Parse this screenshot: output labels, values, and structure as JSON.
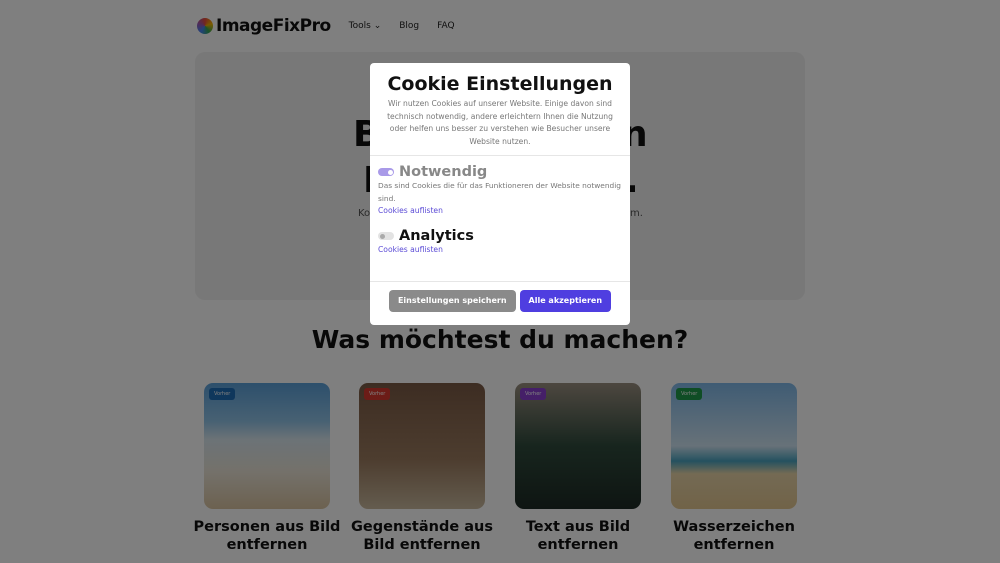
{
  "nav": {
    "logo": "ImageFixPro",
    "tools": "Tools",
    "tools_caret": "⌄",
    "blog": "Blog",
    "faq": "FAQ"
  },
  "hero": {
    "frag1_left": "B",
    "frag1_right": "n",
    "frag2_left": "I",
    "frag2_right": ".",
    "sub_left": "Ko",
    "sub_right": "m."
  },
  "section_title": "Was möchtest du machen?",
  "cards": [
    {
      "badge": "Vorher",
      "title": "Personen aus Bild entfernen",
      "badge_color": "#1f6fb8"
    },
    {
      "badge": "Vorher",
      "title": "Gegenstände aus Bild entfernen",
      "badge_color": "#d9392f"
    },
    {
      "badge": "Vorher",
      "title": "Text aus Bild entfernen",
      "badge_color": "#8a3fd1"
    },
    {
      "badge": "Vorher",
      "title": "Wasserzeichen entfernen",
      "badge_color": "#1e9a4a"
    }
  ],
  "modal": {
    "title": "Cookie Einstellungen",
    "description": "Wir nutzen Cookies auf unserer Website. Einige davon sind technisch notwendig, andere erleichtern Ihnen die Nutzung oder helfen uns besser zu verstehen wie Besucher unsere Website nutzen.",
    "sections": [
      {
        "title": "Notwendig",
        "enabled": true,
        "disabled_toggle": true,
        "description": "Das sind Cookies die für das Funktioneren der Website notwendig sind.",
        "link": "Cookies auflisten"
      },
      {
        "title": "Analytics",
        "enabled": false,
        "description": "",
        "link": "Cookies auflisten"
      }
    ],
    "save_label": "Einstellungen speichern",
    "accept_label": "Alle akzeptieren",
    "accent": "#4f3ee0"
  }
}
